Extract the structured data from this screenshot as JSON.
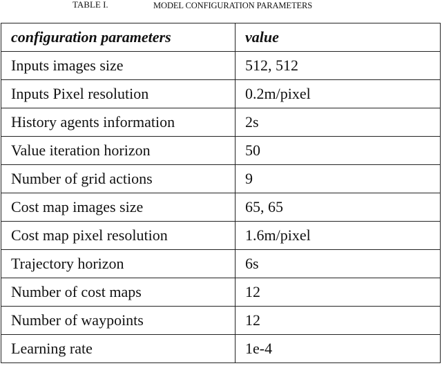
{
  "caption": {
    "number": "TABLE I.",
    "title": "MODEL CONFIGURATION PARAMETERS"
  },
  "table": {
    "headers": [
      "configuration parameters",
      "value"
    ],
    "rows": [
      [
        "Inputs images size",
        "512, 512"
      ],
      [
        "Inputs Pixel resolution",
        "0.2m/pixel"
      ],
      [
        "History agents information",
        "2s"
      ],
      [
        "Value iteration horizon",
        "50"
      ],
      [
        "Number of grid actions",
        "9"
      ],
      [
        "Cost map images size",
        "65, 65"
      ],
      [
        "Cost map pixel resolution",
        "1.6m/pixel"
      ],
      [
        "Trajectory horizon",
        "6s"
      ],
      [
        "Number of cost maps",
        "12"
      ],
      [
        "Number of waypoints",
        "12"
      ],
      [
        "Learning rate",
        "1e-4"
      ]
    ]
  }
}
